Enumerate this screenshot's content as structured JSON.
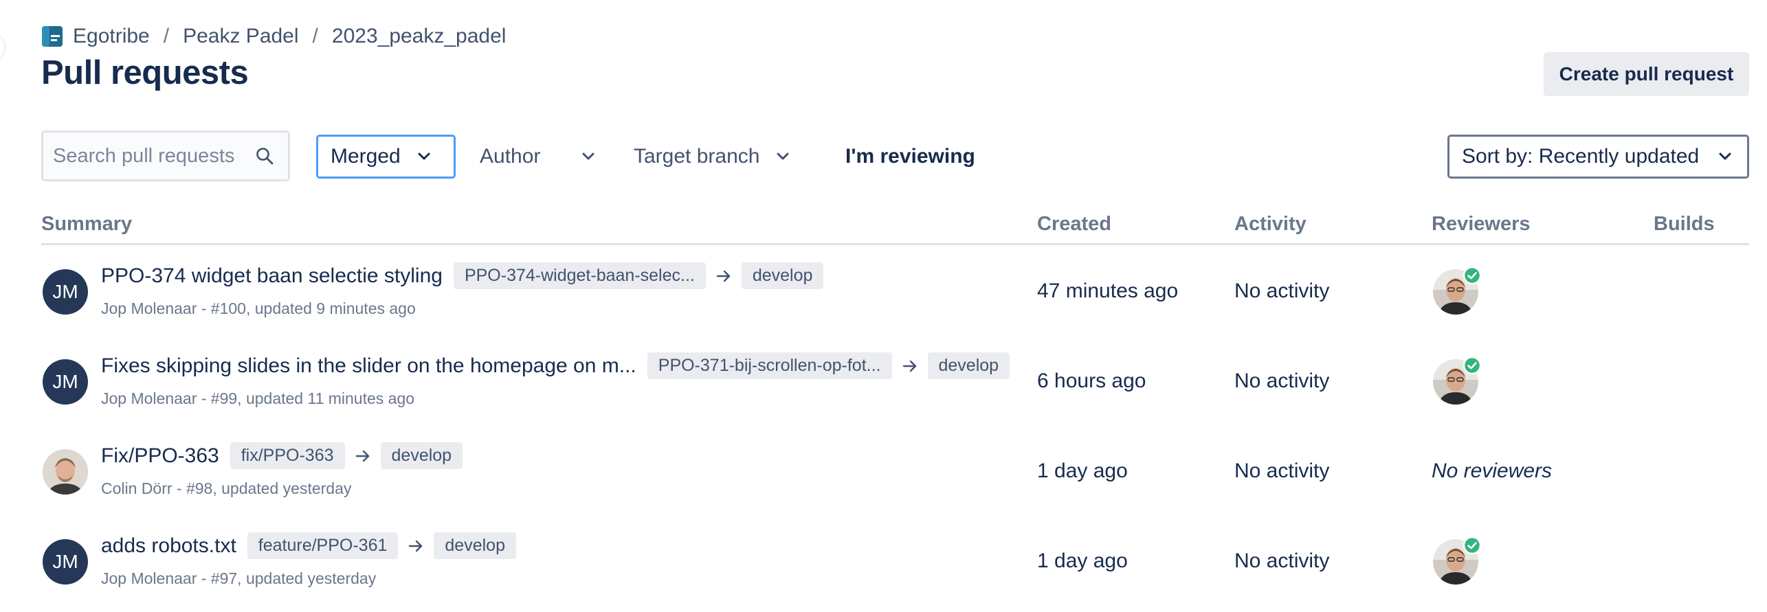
{
  "breadcrumb": {
    "workspace": "Egotribe",
    "project": "Peakz Padel",
    "repository": "2023_peakz_padel",
    "separator": "/"
  },
  "page_title": "Pull requests",
  "actions": {
    "create_label": "Create pull request"
  },
  "filters": {
    "search_placeholder": "Search pull requests",
    "state": "Merged",
    "author": "Author",
    "target_branch": "Target branch",
    "reviewing": "I'm reviewing",
    "sort": "Sort by: Recently updated"
  },
  "columns": {
    "summary": "Summary",
    "created": "Created",
    "activity": "Activity",
    "reviewers": "Reviewers",
    "builds": "Builds"
  },
  "rows": [
    {
      "title": "PPO-374 widget baan selectie styling",
      "source_branch": "PPO-374-widget-baan-selec...",
      "target_branch": "develop",
      "meta": "Jop Molenaar - #100, updated 9 minutes ago",
      "author_initials": "JM",
      "created": "47 minutes ago",
      "activity": "No activity"
    },
    {
      "title": "Fixes skipping slides in the slider on the homepage on m...",
      "source_branch": "PPO-371-bij-scrollen-op-fot...",
      "target_branch": "develop",
      "meta": "Jop Molenaar - #99, updated 11 minutes ago",
      "author_initials": "JM",
      "created": "6 hours ago",
      "activity": "No activity"
    },
    {
      "title": "Fix/PPO-363",
      "source_branch": "fix/PPO-363",
      "target_branch": "develop",
      "meta": "Colin Dörr - #98, updated yesterday",
      "created": "1 day ago",
      "activity": "No activity",
      "reviewers_text": "No reviewers"
    },
    {
      "title": "adds robots.txt",
      "source_branch": "feature/PPO-361",
      "target_branch": "develop",
      "meta": "Jop Molenaar - #97, updated yesterday",
      "author_initials": "JM",
      "created": "1 day ago",
      "activity": "No activity"
    }
  ],
  "colors": {
    "text_primary": "#172b4d",
    "text_secondary": "#6b778c",
    "focus_border": "#4c9aff",
    "avatar_bg": "#253858",
    "chip_bg": "#ebecf0",
    "approved_green": "#36b37e",
    "repo_icon": "#1f6b8c"
  },
  "icons": {
    "repo": "repository-icon",
    "search": "search-icon",
    "dropdown": "chevron-down-icon",
    "branch_arrow": "arrow-right-icon",
    "approved": "check-circle-icon"
  }
}
